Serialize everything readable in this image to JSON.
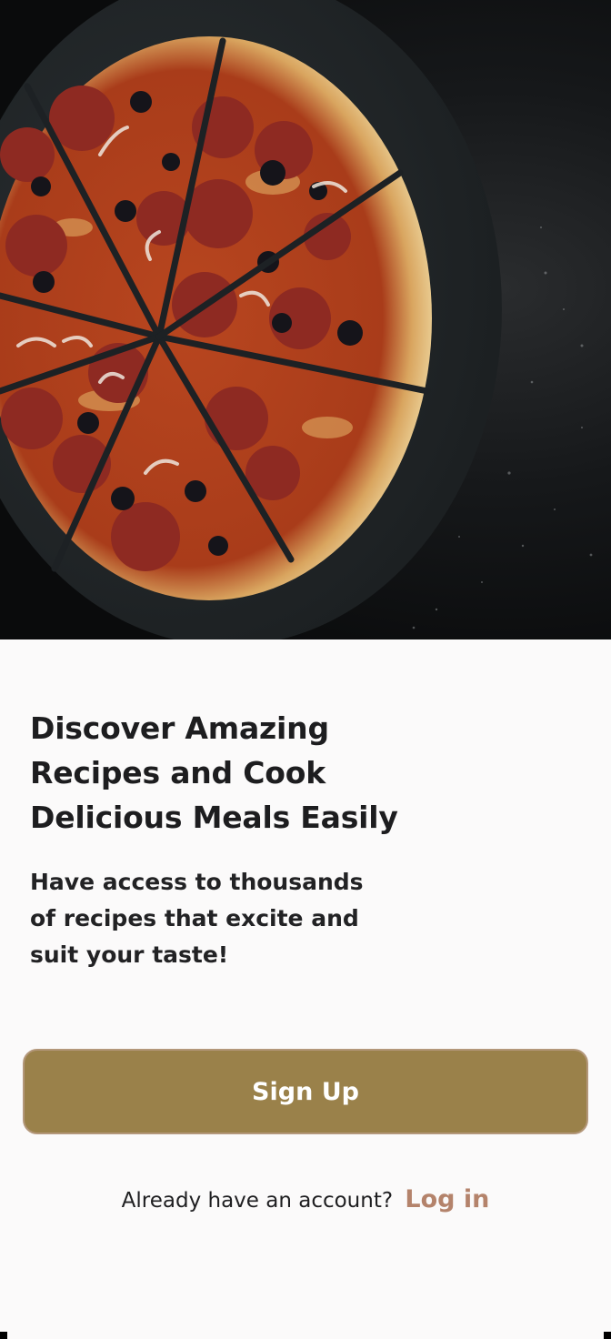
{
  "hero": {
    "image_icon": "pizza-photo"
  },
  "content": {
    "headline": "Discover Amazing Recipes and Cook Delicious Meals Easily",
    "subtext": "Have access to thousands of recipes that excite and suit your taste!"
  },
  "actions": {
    "signup_label": "Sign Up",
    "login_prompt": "Already have an account?",
    "login_label": "Log in"
  },
  "colors": {
    "accent": "#9a814a",
    "accent_border": "#b3977a",
    "link": "#b4836b",
    "background": "#fbfafa"
  }
}
